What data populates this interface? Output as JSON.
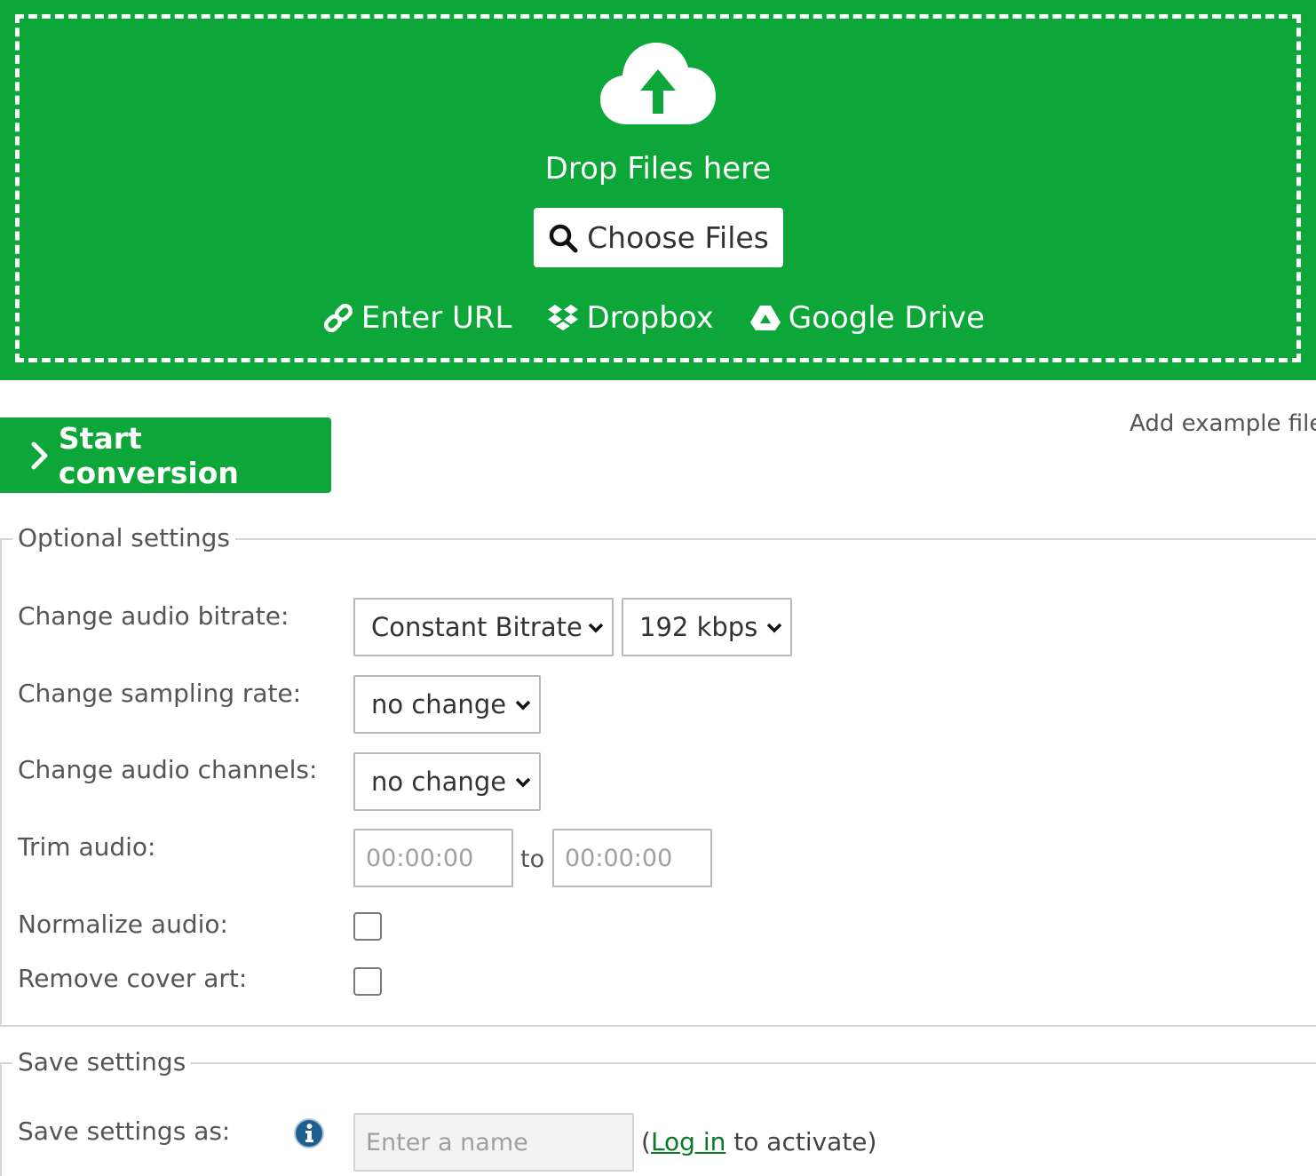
{
  "upload": {
    "drop_text": "Drop Files here",
    "choose_label": "Choose Files",
    "sources": [
      {
        "label": "Enter URL",
        "icon": "link-icon"
      },
      {
        "label": "Dropbox",
        "icon": "dropbox-icon"
      },
      {
        "label": "Google Drive",
        "icon": "google-drive-icon"
      }
    ],
    "icon": "cloud-upload-icon"
  },
  "actions": {
    "start_label": "Start conversion",
    "example_label": "Add example file"
  },
  "optional": {
    "legend": "Optional settings",
    "bitrate": {
      "label": "Change audio bitrate:",
      "mode": "Constant Bitrate",
      "value": "192 kbps"
    },
    "sampling": {
      "label": "Change sampling rate:",
      "value": "no change"
    },
    "channels": {
      "label": "Change audio channels:",
      "value": "no change"
    },
    "trim": {
      "label": "Trim audio:",
      "from_placeholder": "00:00:00",
      "to_text": "to",
      "to_placeholder": "00:00:00"
    },
    "normalize": {
      "label": "Normalize audio:",
      "checked": false
    },
    "cover": {
      "label": "Remove cover art:",
      "checked": false
    }
  },
  "save": {
    "legend": "Save settings",
    "label": "Save settings as:",
    "name_placeholder": "Enter a name",
    "note_open": "(",
    "login_link": "Log in",
    "note_rest": " to activate)"
  },
  "colors": {
    "brand_green": "#0ca639",
    "link_green": "#0a7a2a",
    "info_blue": "#1f5f8f"
  }
}
